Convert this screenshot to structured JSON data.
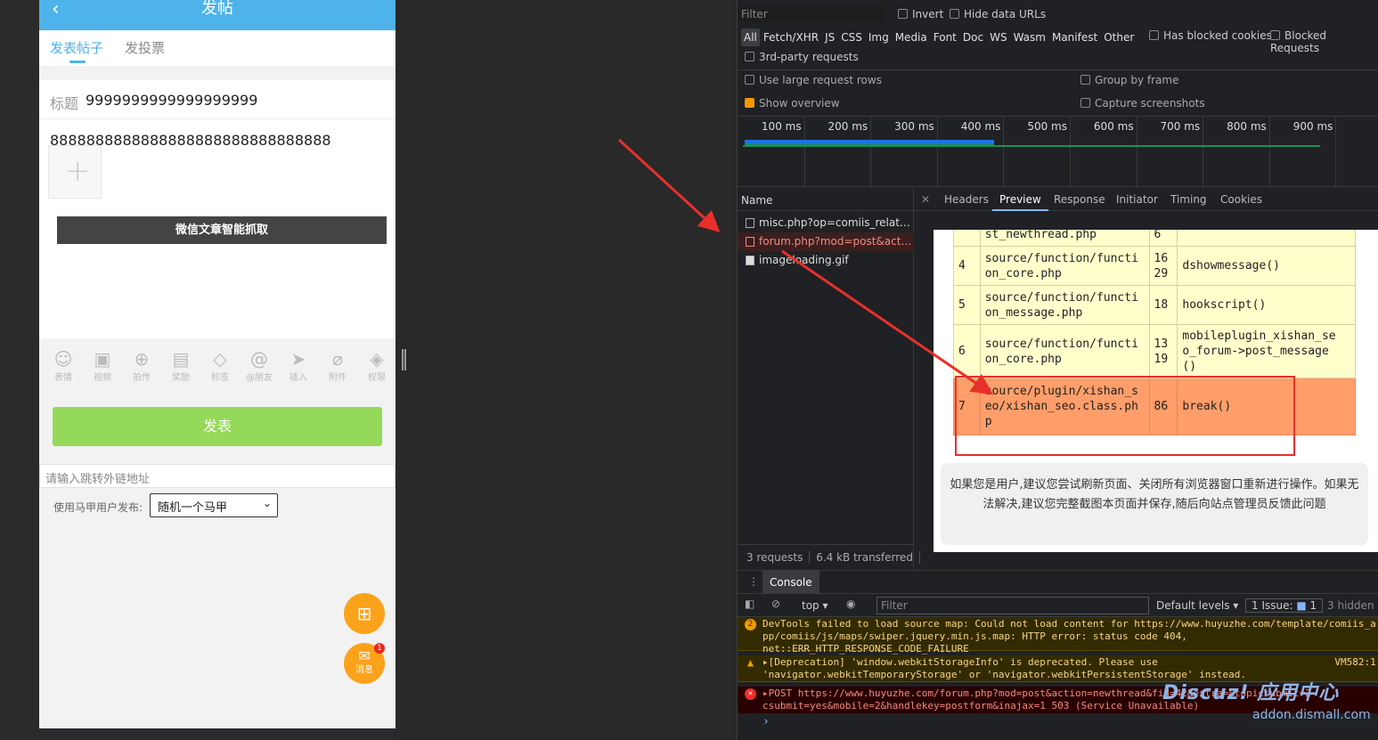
{
  "phone": {
    "header_title": "发帖",
    "tabs": [
      "发表帖子",
      "发投票"
    ],
    "form": {
      "title_label": "标题",
      "title_value": "9999999999999999999",
      "content_value": "8888888888888888888888888888888",
      "add_symbol": "+",
      "wechat_button": "微信文章智能抓取"
    },
    "toolbar": [
      {
        "icon": "☺",
        "label": "表情"
      },
      {
        "icon": "▣",
        "label": "视频"
      },
      {
        "icon": "⊕",
        "label": "拍传"
      },
      {
        "icon": "▤",
        "label": "奖励"
      },
      {
        "icon": "◇",
        "label": "标签"
      },
      {
        "icon": "@",
        "label": "@朋友"
      },
      {
        "icon": "➤",
        "label": "插入"
      },
      {
        "icon": "⌀",
        "label": "附件"
      },
      {
        "icon": "◈",
        "label": "权限"
      }
    ],
    "post_button": "发表",
    "link_placeholder": "请输入跳转外链地址",
    "majia_label": "使用马甲用户发布:",
    "majia_selected": "随机一个马甲",
    "fab_grid_icon": "grid-icon",
    "fab_message_label": "消息",
    "fab_badge": "1"
  },
  "devtools": {
    "filter_placeholder": "Filter",
    "invert": "Invert",
    "hide_data_urls": "Hide data URLs",
    "types": [
      "All",
      "Fetch/XHR",
      "JS",
      "CSS",
      "Img",
      "Media",
      "Font",
      "Doc",
      "WS",
      "Wasm",
      "Manifest",
      "Other"
    ],
    "has_blocked_cookies": "Has blocked cookies",
    "blocked_requests": "Blocked Requests",
    "third_party": "3rd-party requests",
    "large_rows": "Use large request rows",
    "group_by_frame": "Group by frame",
    "show_overview": "Show overview",
    "capture_screenshots": "Capture screenshots",
    "ticks": [
      "100 ms",
      "200 ms",
      "300 ms",
      "400 ms",
      "500 ms",
      "600 ms",
      "700 ms",
      "800 ms",
      "900 ms",
      "100"
    ],
    "name_header": "Name",
    "requests": [
      "misc.php?op=comiis_relatekw...",
      "forum.php?mod=post&action...",
      "imageloading.gif"
    ],
    "status": {
      "requests": "3 requests",
      "transferred": "6.4 kB transferred"
    },
    "detail_tabs": [
      "Headers",
      "Preview",
      "Response",
      "Initiator",
      "Timing",
      "Cookies"
    ],
    "trace_rows": [
      {
        "n": "",
        "file": "st_newthread.php",
        "line": "6",
        "fn": ""
      },
      {
        "n": "4",
        "file": "source/function/functi\non_core.php",
        "line": "16\n29",
        "fn": "dshowmessage()"
      },
      {
        "n": "5",
        "file": "source/function/functi\non_message.php",
        "line": "18",
        "fn": "hookscript()"
      },
      {
        "n": "6",
        "file": "source/function/functi\non_core.php",
        "line": "13\n19",
        "fn": "mobileplugin_xishan_se\no_forum->post_message\n()"
      },
      {
        "n": "7",
        "file": "source/plugin/xishan_s\neo/xishan_seo.class.ph\np",
        "line": "86",
        "fn": "break()"
      }
    ],
    "message": "如果您是用户,建议您尝试刷新页面、关闭所有浏览器窗口重新进行操作。如果无法解决,建议您完整截图本页面并保存,随后向站点管理员反馈此问题",
    "console_tab": "Console",
    "context": "top",
    "console_filter": "Filter",
    "default_levels": "Default levels",
    "issues": "1 Issue:",
    "issues_count": "1",
    "hidden": "3 hidden",
    "logs": [
      "DevTools failed to load source map: Could not load content for https://www.huyuzhe.com/template/comiis_a\npp/comiis/js/maps/swiper.jquery.min.js.map: HTTP error: status code 404,\nnet::ERR_HTTP_RESPONSE_CODE_FAILURE",
      "▸[Deprecation] 'window.webkitStorageInfo' is deprecated. Please use                              VM582:1\n'navigator.webkitTemporaryStorage' or 'navigator.webkitPersistentStorage' instead.",
      "▸POST https://www.huyuzhe.com/forum.php?mod=post&action=newthread&fid=42&extra=&topicsubmit=2\ncsubmit=yes&mobile=2&handlekey=postform&inajax=1 503 (Service Unavailable)"
    ],
    "log_counts": [
      "2"
    ],
    "prompt": "›"
  },
  "watermark": {
    "brand": "Discuz! 应用中心",
    "url": "addon.dismall.com"
  },
  "colors": {
    "phone_header": "#4db3ea",
    "post_button": "#95d95a",
    "fab": "#fba21b",
    "highlight_row": "#ff9e6a",
    "arrow": "#e8302a"
  }
}
